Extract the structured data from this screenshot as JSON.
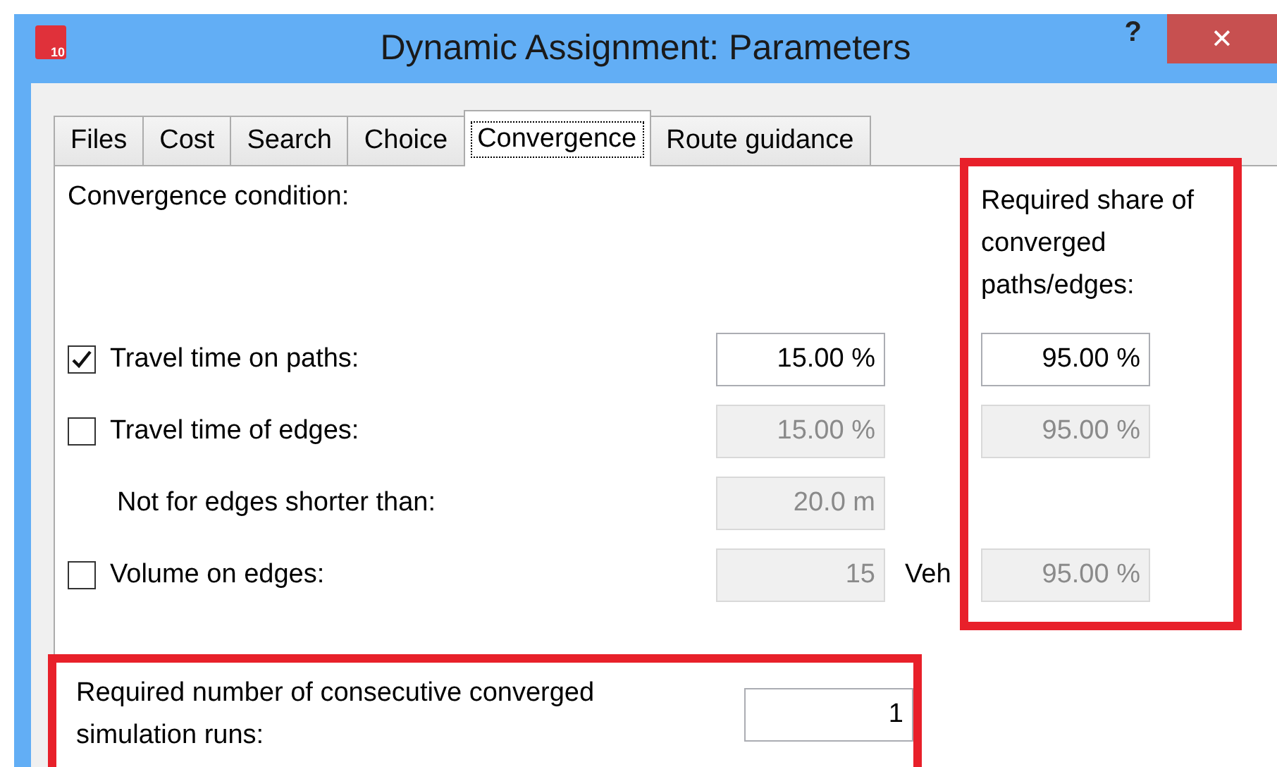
{
  "window": {
    "title": "Dynamic Assignment: Parameters",
    "icon_badge": "10",
    "help": "?",
    "close": "✕"
  },
  "tabs": [
    {
      "label": "Files",
      "selected": false
    },
    {
      "label": "Cost",
      "selected": false
    },
    {
      "label": "Search",
      "selected": false
    },
    {
      "label": "Choice",
      "selected": false
    },
    {
      "label": "Convergence",
      "selected": true
    },
    {
      "label": "Route guidance",
      "selected": false
    }
  ],
  "convergence": {
    "heading": "Convergence condition:",
    "share_heading": "Required share of converged paths/edges:",
    "share_highlighted": true,
    "conditions": [
      {
        "kind": "checkbox",
        "label": "Travel time on paths:",
        "checked": true,
        "value": "15.00 %",
        "disabled": false,
        "share": {
          "value": "95.00 %",
          "disabled": false
        }
      },
      {
        "kind": "checkbox",
        "label": "Travel time of edges:",
        "checked": false,
        "value": "15.00 %",
        "disabled": true,
        "share": {
          "value": "95.00 %",
          "disabled": true
        }
      },
      {
        "kind": "plain",
        "label": "Not for edges shorter than:",
        "value": "20.0 m",
        "disabled": true
      },
      {
        "kind": "checkbox",
        "label": "Volume on edges:",
        "checked": false,
        "value": "15",
        "disabled": true,
        "unit": "Veh",
        "share": {
          "value": "95.00 %",
          "disabled": true
        }
      }
    ]
  },
  "runs": {
    "label": "Required number of consecutive converged simulation runs:",
    "value": "1",
    "highlighted": true
  }
}
